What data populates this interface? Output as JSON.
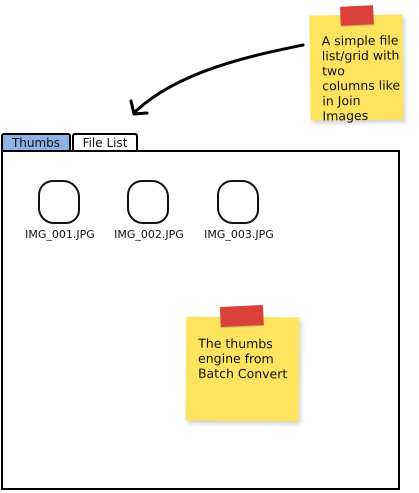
{
  "tabs": [
    {
      "label": "Thumbs",
      "active": true
    },
    {
      "label": "File List",
      "active": false
    }
  ],
  "thumbnails": [
    {
      "filename": "IMG_001.JPG"
    },
    {
      "filename": "IMG_002.JPG"
    },
    {
      "filename": "IMG_003.JPG"
    }
  ],
  "notes": [
    {
      "text": "A simple file list/grid with two columns like in Join Images"
    },
    {
      "text": "The thumbs engine from Batch Convert"
    }
  ],
  "colors": {
    "active_tab": "#8fb2e6",
    "sticky_note": "#fde35e",
    "tape": "#d9413a"
  }
}
